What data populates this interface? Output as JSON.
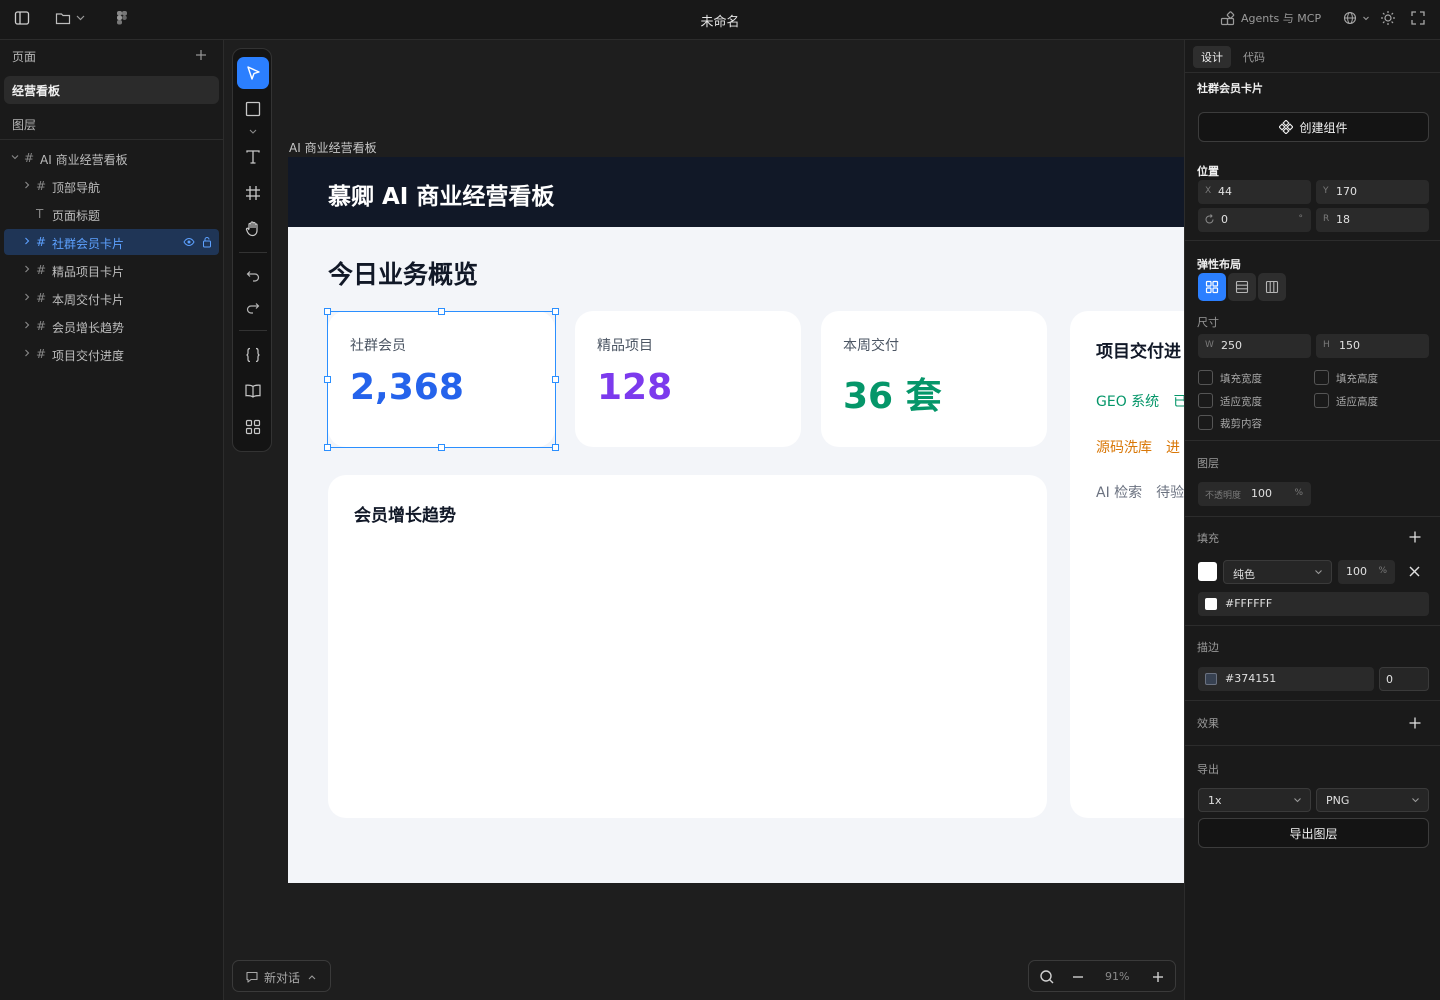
{
  "app": {
    "doc_title": "未命名",
    "agents_label": "Agents 与 MCP"
  },
  "left": {
    "pages_title": "页面",
    "current_page": "经营看板",
    "layers_title": "图层",
    "layers": [
      {
        "name": "AI 商业经营看板"
      },
      {
        "name": "顶部导航"
      },
      {
        "name": "页面标题"
      },
      {
        "name": "社群会员卡片"
      },
      {
        "name": "精品项目卡片"
      },
      {
        "name": "本周交付卡片"
      },
      {
        "name": "会员增长趋势"
      },
      {
        "name": "项目交付进度"
      }
    ]
  },
  "canvas": {
    "frame_label": "AI 商业经营看板",
    "header_title": "慕卿 AI 商业经营看板",
    "overview_title": "今日业务概览",
    "cards": [
      {
        "label": "社群会员",
        "value": "2,368",
        "color": "#2563eb"
      },
      {
        "label": "精品项目",
        "value": "128",
        "color": "#7c3aed"
      },
      {
        "label": "本周交付",
        "value": "36 套",
        "color": "#059669"
      }
    ],
    "trend_title": "会员增长趋势",
    "progress": {
      "title": "项目交付进",
      "rows": [
        {
          "name": "GEO 系统",
          "status": "已",
          "color": "#059669"
        },
        {
          "name": "源码洗库",
          "status": "进",
          "color": "#d97706"
        },
        {
          "name": "AI 检索",
          "status": "待验",
          "color": "#6b7280"
        }
      ]
    }
  },
  "bottom": {
    "chat_label": "新对话",
    "zoom": "91%"
  },
  "right": {
    "tabs": [
      "设计",
      "代码"
    ],
    "selection_name": "社群会员卡片",
    "create_component": "创建组件",
    "position": {
      "title": "位置",
      "x_label": "X",
      "x": "44",
      "y_label": "Y",
      "y": "170",
      "rotation": "0",
      "rotation_unit": "°",
      "r_label": "R",
      "radius": "18"
    },
    "flex_title": "弹性布局",
    "size": {
      "title": "尺寸",
      "w_label": "W",
      "w": "250",
      "h_label": "H",
      "h": "150"
    },
    "checks": [
      "填充宽度",
      "填充高度",
      "适应宽度",
      "适应高度",
      "裁剪内容"
    ],
    "layer": {
      "title": "图层",
      "opacity_label": "不透明度",
      "opacity": "100",
      "unit": "%"
    },
    "fill": {
      "title": "填充",
      "type": "纯色",
      "opacity": "100",
      "unit": "%",
      "hex": "#FFFFFF",
      "swatch": "#ffffff"
    },
    "stroke": {
      "title": "描边",
      "hex": "#374151",
      "width": "0",
      "swatch": "#374151"
    },
    "effects_title": "效果",
    "export": {
      "title": "导出",
      "scale": "1x",
      "format": "PNG",
      "button": "导出图层"
    }
  }
}
